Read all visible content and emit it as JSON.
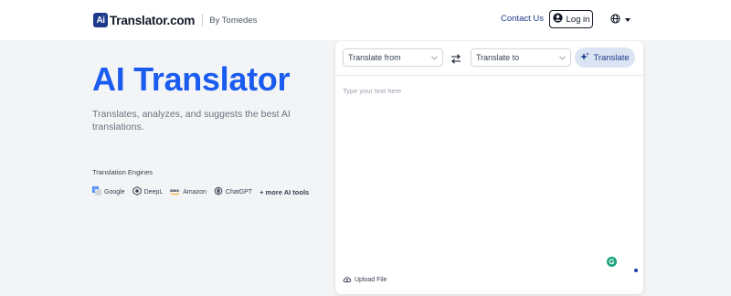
{
  "header": {
    "logo_badge": "Ai",
    "logo_text": "Translator.com",
    "by_text": "By Tomedes",
    "contact_label": "Contact Us",
    "login_label": "Log in",
    "language_icon": "globe-icon"
  },
  "hero": {
    "title": "AI Translator",
    "subtitle": "Translates, analyzes, and suggests the best AI translations.",
    "engines_label": "Translation Engines",
    "engines": [
      {
        "name": "Google",
        "icon": "google-translate-icon"
      },
      {
        "name": "DeepL",
        "icon": "deepl-icon"
      },
      {
        "name": "Amazon",
        "icon": "amazon-icon"
      },
      {
        "name": "ChatGPT",
        "icon": "chatgpt-icon"
      }
    ],
    "more_tools": "+ more AI tools"
  },
  "translator": {
    "from_label": "Translate from",
    "to_label": "Translate to",
    "translate_label": "Translate",
    "placeholder": "Type your text here",
    "upload_label": "Upload File"
  },
  "colors": {
    "accent": "#1a5cf0",
    "brand_dark": "#1e3a8a",
    "translate_btn_bg": "#dbe4f3",
    "page_bg": "#f3f4f5"
  }
}
